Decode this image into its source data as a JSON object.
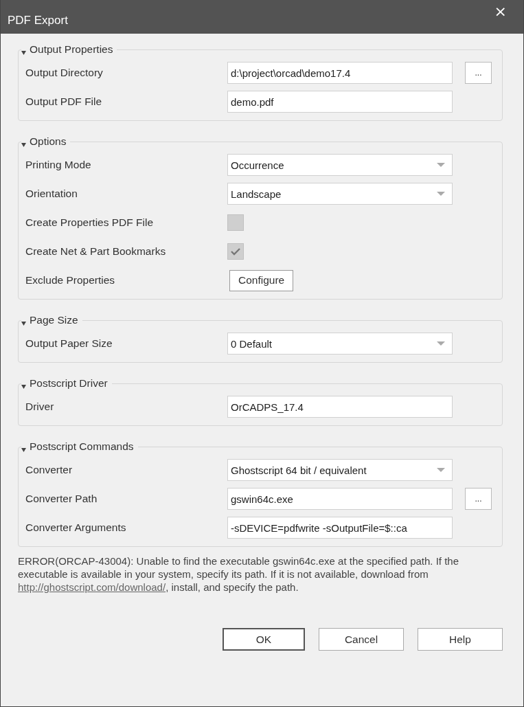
{
  "window": {
    "title": "PDF Export",
    "close": "×"
  },
  "groups": [
    {
      "title": "Output Properties",
      "expanded": true,
      "rows": [
        {
          "kind": "browse",
          "label": "Output Directory",
          "value": "d:\\project\\orcad\\demo17.4",
          "button": "..."
        },
        {
          "kind": "text",
          "label": "Output PDF File",
          "value": "demo.pdf"
        }
      ]
    },
    {
      "title": "Options",
      "expanded": true,
      "rows": [
        {
          "kind": "combo",
          "label": "Printing Mode",
          "value": "Occurrence"
        },
        {
          "kind": "combo",
          "label": "Orientation",
          "value": "Landscape"
        },
        {
          "kind": "checkbox",
          "label": "Create Properties PDF File",
          "checked": false
        },
        {
          "kind": "checkbox",
          "label": "Create Net & Part Bookmarks",
          "checked": true
        },
        {
          "kind": "button",
          "label": "Exclude Properties",
          "button": "Configure"
        }
      ]
    },
    {
      "title": "Page Size",
      "expanded": true,
      "rows": [
        {
          "kind": "combo",
          "label": "Output Paper Size",
          "value": "0 Default"
        }
      ]
    },
    {
      "title": "Postscript Driver",
      "expanded": true,
      "rows": [
        {
          "kind": "text",
          "label": "Driver",
          "value": "OrCADPS_17.4"
        }
      ]
    },
    {
      "title": "Postscript Commands",
      "expanded": true,
      "rows": [
        {
          "kind": "combo",
          "label": "Converter",
          "value": "Ghostscript 64 bit / equivalent"
        },
        {
          "kind": "browse",
          "label": "Converter Path",
          "value": "gswin64c.exe",
          "button": "..."
        },
        {
          "kind": "text",
          "label": "Converter Arguments",
          "value": "-sDEVICE=pdfwrite -sOutputFile=$::ca"
        }
      ]
    }
  ],
  "message": {
    "before": "ERROR(ORCAP-43004): Unable to find the executable gswin64c.exe at the specified path. If the executable is available in your system, specify its path. If it is not available, download from ",
    "link": "http://ghostscript.com/download/",
    "after": ", install, and specify the path."
  },
  "buttons": [
    {
      "label": "OK",
      "default": true
    },
    {
      "label": "Cancel",
      "default": false
    },
    {
      "label": "Help",
      "default": false
    }
  ]
}
